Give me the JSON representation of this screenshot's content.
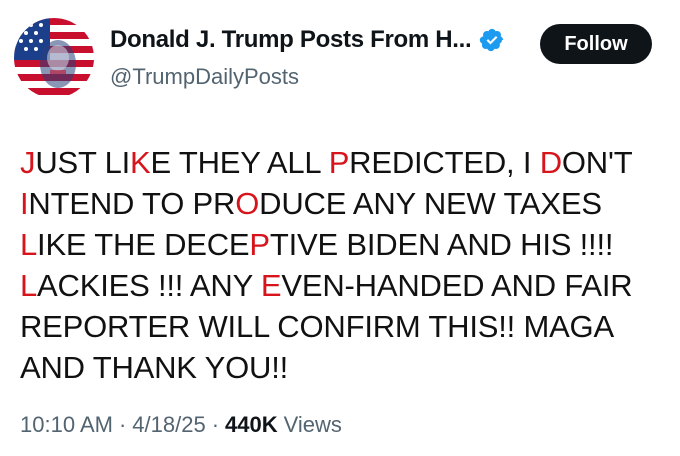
{
  "author": {
    "display_name": "Donald J. Trump Posts From H...",
    "handle": "@TrumpDailyPosts",
    "verified": true,
    "avatar_icon": "us-flag-portrait-avatar"
  },
  "follow_button": {
    "label": "Follow"
  },
  "post": {
    "segments": [
      {
        "text": "J",
        "highlight": true
      },
      {
        "text": "UST LI",
        "highlight": false
      },
      {
        "text": "K",
        "highlight": true
      },
      {
        "text": "E THEY ALL ",
        "highlight": false
      },
      {
        "text": "P",
        "highlight": true
      },
      {
        "text": "REDICTED, I ",
        "highlight": false
      },
      {
        "text": "D",
        "highlight": true
      },
      {
        "text": "ON'T ",
        "highlight": false
      },
      {
        "text": "I",
        "highlight": true
      },
      {
        "text": "NTEND TO PR",
        "highlight": false
      },
      {
        "text": "O",
        "highlight": true
      },
      {
        "text": "DUCE ANY NEW TAXES ",
        "highlight": false
      },
      {
        "text": "L",
        "highlight": true
      },
      {
        "text": "IKE THE DECE",
        "highlight": false
      },
      {
        "text": "P",
        "highlight": true
      },
      {
        "text": "TIVE BIDEN AND HIS !!!! ",
        "highlight": false
      },
      {
        "text": "L",
        "highlight": true
      },
      {
        "text": "ACKIES !!! ANY ",
        "highlight": false
      },
      {
        "text": "E",
        "highlight": true
      },
      {
        "text": "VEN-HANDED AND FAIR REPORTER WILL CONFIRM THIS!! MAGA AND THANK YOU!!",
        "highlight": false
      }
    ],
    "highlight_color": "#d7141b"
  },
  "meta": {
    "time": "10:10 AM",
    "separator": "·",
    "date": "4/18/25",
    "views_count": "440K",
    "views_label": "Views"
  },
  "colors": {
    "text_primary": "#0f1419",
    "text_secondary": "#536471",
    "verified_blue": "#1d9bf0",
    "button_bg": "#0f1419"
  }
}
